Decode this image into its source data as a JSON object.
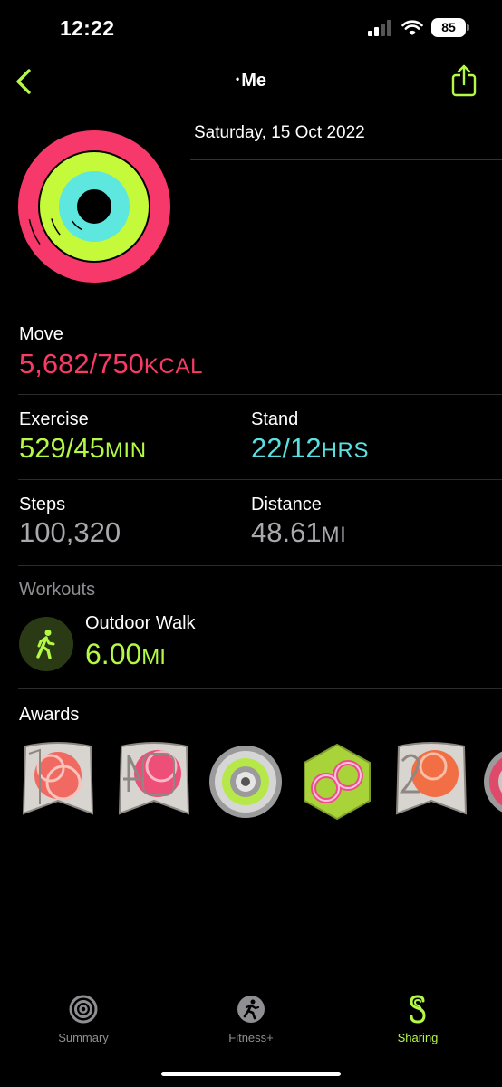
{
  "status_bar": {
    "time": "12:22",
    "battery": "85"
  },
  "nav": {
    "dot": "•",
    "title": "Me"
  },
  "summary": {
    "date": "Saturday, 15 Oct 2022"
  },
  "metrics": {
    "move": {
      "label": "Move",
      "value": "5,682/750",
      "unit": "KCAL"
    },
    "exercise": {
      "label": "Exercise",
      "value": "529/45",
      "unit": "MIN"
    },
    "stand": {
      "label": "Stand",
      "value": "22/12",
      "unit": "HRS"
    },
    "steps": {
      "label": "Steps",
      "value": "100,320"
    },
    "distance": {
      "label": "Distance",
      "value": "48.61",
      "unit": "MI"
    }
  },
  "rings": {
    "move_color": "#f7386a",
    "exercise_color": "#c4fa3a",
    "stand_color": "#5ee7de"
  },
  "workouts": {
    "heading": "Workouts",
    "items": [
      {
        "name": "Outdoor Walk",
        "value": "6.00",
        "unit": "MI",
        "icon": "walk-icon"
      }
    ]
  },
  "awards": {
    "heading": "Awards",
    "items": [
      {
        "icon": "award-badge-30-icon"
      },
      {
        "icon": "award-badge-40-icon"
      },
      {
        "icon": "award-ring-icon"
      },
      {
        "icon": "award-infinity-icon"
      },
      {
        "icon": "award-badge-20-icon"
      },
      {
        "icon": "award-partial-icon"
      }
    ]
  },
  "tabbar": {
    "tabs": [
      {
        "label": "Summary",
        "icon": "summary-rings-icon",
        "active": false
      },
      {
        "label": "Fitness+",
        "icon": "fitness-plus-icon",
        "active": false
      },
      {
        "label": "Sharing",
        "icon": "sharing-icon",
        "active": true
      }
    ],
    "active_color": "#b4f945",
    "inactive_color": "#8e8e93"
  }
}
